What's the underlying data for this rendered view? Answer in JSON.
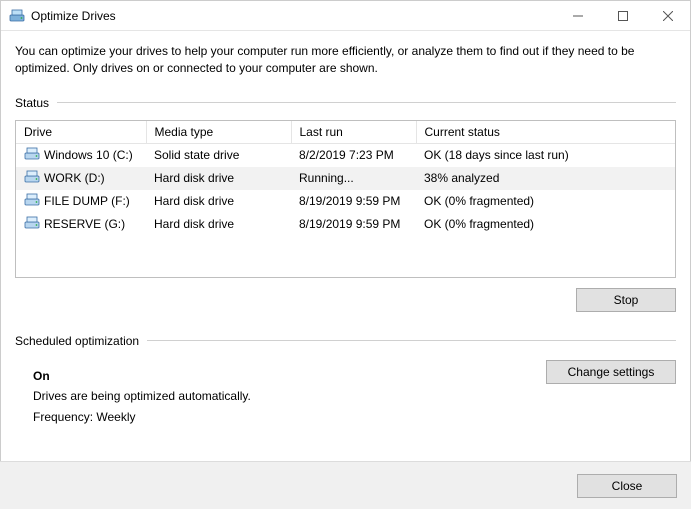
{
  "window": {
    "title": "Optimize Drives"
  },
  "description": "You can optimize your drives to help your computer run more efficiently, or analyze them to find out if they need to be optimized. Only drives on or connected to your computer are shown.",
  "status_label": "Status",
  "columns": {
    "drive": "Drive",
    "media": "Media type",
    "last_run": "Last run",
    "current": "Current status"
  },
  "drives": [
    {
      "name": "Windows 10 (C:)",
      "media": "Solid state drive",
      "last_run": "8/2/2019 7:23 PM",
      "status": "OK (18 days since last run)",
      "selected": false
    },
    {
      "name": "WORK (D:)",
      "media": "Hard disk drive",
      "last_run": "Running...",
      "status": "38% analyzed",
      "selected": true
    },
    {
      "name": "FILE DUMP (F:)",
      "media": "Hard disk drive",
      "last_run": "8/19/2019 9:59 PM",
      "status": "OK (0% fragmented)",
      "selected": false
    },
    {
      "name": "RESERVE (G:)",
      "media": "Hard disk drive",
      "last_run": "8/19/2019 9:59 PM",
      "status": "OK (0% fragmented)",
      "selected": false
    }
  ],
  "buttons": {
    "stop": "Stop",
    "change_settings": "Change settings",
    "close": "Close"
  },
  "scheduled": {
    "heading": "Scheduled optimization",
    "state": "On",
    "line1": "Drives are being optimized automatically.",
    "line2": "Frequency: Weekly"
  }
}
